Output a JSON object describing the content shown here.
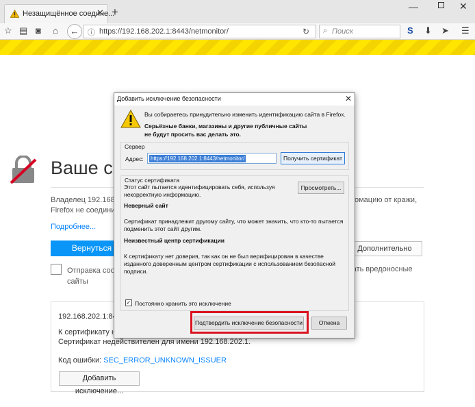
{
  "browser": {
    "tab_title": "Незащищённое соедине...",
    "tab_close": "✕",
    "new_tab": "+",
    "url": "https://192.168.202.1:8443/netmonitor/",
    "search_placeholder": "Поиск",
    "win_min": "—",
    "win_close": "✕"
  },
  "page": {
    "title": "Ваше со",
    "para1_left": "Владелец 192.168.2",
    "para1_right": "омацию от кражи,",
    "para2_left": "Firefox не соедини",
    "more_link": "Подробнее...",
    "back_button": "Вернуться",
    "advanced_button": "Дополнительно",
    "report_line1": "Отправка сооб",
    "report_line2": "сайты",
    "report_right": "вать вредоносные",
    "details": {
      "host": "192.168.202.1:8443",
      "line1": "К сертификату нет",
      "line2": "Сертификат недействителен для имени 192.168.202.1.",
      "error_label": "Код ошибки:",
      "error_code": "SEC_ERROR_UNKNOWN_ISSUER",
      "add_exception_button": "Добавить исключение..."
    }
  },
  "dialog": {
    "title": "Добавить исключение безопасности",
    "close": "✕",
    "warning_line": "Вы собираетесь принудительно изменить идентификацию сайта в Firefox.",
    "warning_bold": "Серьёзные банки, магазины и другие публичные сайты не будут просить вас делать это.",
    "server": {
      "group_label": "Сервер",
      "address_label": "Адрес:",
      "address_value": "https://192.168.202.1:8443/netmonitor/",
      "get_cert_button": "Получить сертификат"
    },
    "status": {
      "group_label": "Статус сертификата",
      "intro": "Этот сайт пытается идентифицировать себя, используя некорректную информацию.",
      "view_button": "Просмотреть...",
      "h1": "Неверный сайт",
      "t1": "Сертификат принадлежит другому сайту, что может значить, что кто-то пытается подменить этот сайт другим.",
      "h2": "Неизвестный центр сертификации",
      "t2": "К сертификату нет доверия, так как он не был верифицирован в качестве изданного доверенным центром сертификации с использованием безопасной подписи.",
      "permanent_label": "Постоянно хранить это исключение",
      "permanent_checked": true
    },
    "confirm_button": "Подтвердить исключение безопасности",
    "cancel_button": "Отмена"
  },
  "colors": {
    "highlight": "#d9141f",
    "link": "#0a84ff",
    "primary_button": "#0996f8"
  }
}
